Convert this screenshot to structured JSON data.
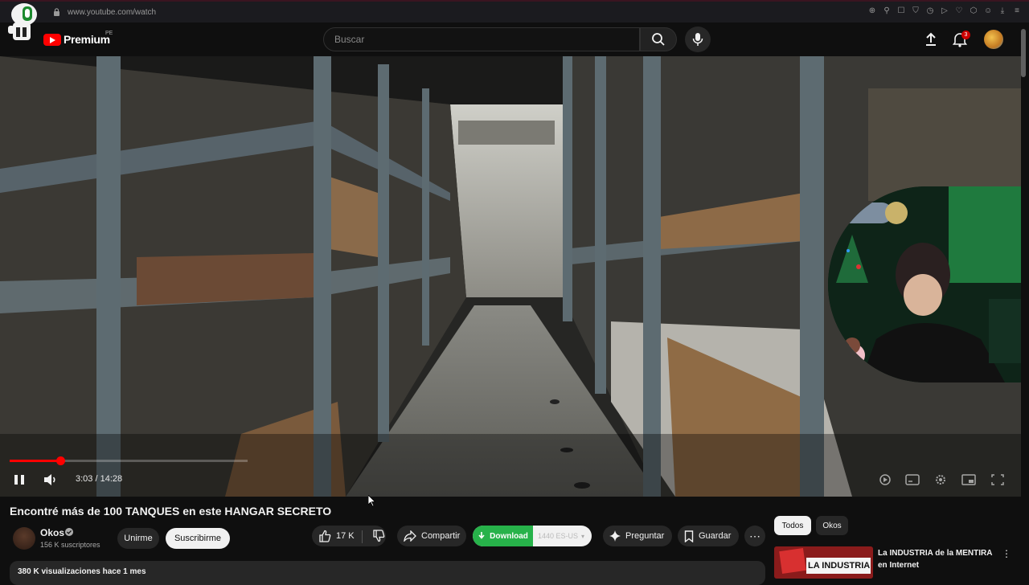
{
  "browser": {
    "url": "www.youtube.com/watch"
  },
  "header": {
    "logo_text": "Premium",
    "country_code": "PE",
    "search_placeholder": "Buscar",
    "notification_count": "3"
  },
  "player": {
    "time_display": "3:03 / 14:28",
    "progress_fraction": 0.213,
    "buffer_fraction": 0.33,
    "state": "playing"
  },
  "video": {
    "title": "Encontré más de 100 TANQUES en este HANGAR SECRETO",
    "channel_name": "Okos",
    "subscribers": "156 K suscriptores",
    "join_label": "Unirme",
    "subscribe_label": "Suscribirme",
    "likes": "17 K",
    "share_label": "Compartir",
    "download_label": "Download",
    "download_quality": "1440 ES-US",
    "ask_label": "Preguntar",
    "save_label": "Guardar",
    "views_date": "380 K visualizaciones  hace 1 mes"
  },
  "sidebar": {
    "chips": [
      {
        "label": "Todos",
        "selected": true
      },
      {
        "label": "Okos",
        "selected": false
      }
    ],
    "recommendations": [
      {
        "title": "La INDUSTRIA de la MENTIRA en Internet",
        "thumb_text": "LA INDUSTRIA"
      }
    ]
  },
  "colors": {
    "accent": "#ff0000",
    "download_green": "#27b24a",
    "background": "#0f0f0f"
  }
}
